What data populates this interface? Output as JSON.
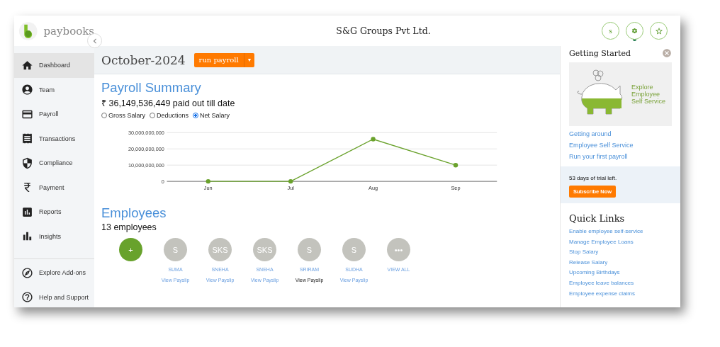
{
  "brand": {
    "name": "paybooks"
  },
  "header": {
    "title": "S&G Groups Pvt Ltd.",
    "icons": [
      {
        "label": "s",
        "selected": false
      },
      {
        "kind": "gear",
        "selected": true
      },
      {
        "kind": "star",
        "selected": false
      }
    ]
  },
  "sidebar": {
    "items": [
      {
        "label": "Dashboard",
        "selected": true
      },
      {
        "label": "Team",
        "selected": false
      },
      {
        "label": "Payroll",
        "selected": false
      },
      {
        "label": "Transactions",
        "selected": false
      },
      {
        "label": "Compliance",
        "selected": false
      },
      {
        "label": "Payment",
        "selected": false
      },
      {
        "label": "Reports",
        "selected": false
      },
      {
        "label": "Insights",
        "selected": false
      }
    ],
    "footer_items": [
      {
        "label": "Explore Add-ons"
      },
      {
        "label": "Help and Support"
      }
    ]
  },
  "period": {
    "title": "October-2024",
    "button": "run payroll",
    "menu_icon": "▾"
  },
  "payroll_summary": {
    "title": "Payroll Summary",
    "total": "₹ 36,149,536,449 paid out till date",
    "options": [
      {
        "label": "Gross Salary",
        "selected": false
      },
      {
        "label": "Deductions",
        "selected": false
      },
      {
        "label": "Net Salary",
        "selected": true
      }
    ],
    "chart_data": {
      "type": "line",
      "categories": [
        "Jun",
        "Jul",
        "Aug",
        "Sep"
      ],
      "series": [
        {
          "color": "#6aa22c",
          "marker": "circle",
          "values": [
            0,
            0,
            26000000000,
            10000000000
          ]
        }
      ],
      "ylim": [
        0,
        30000000000
      ],
      "yticks": [
        {
          "value": 0,
          "label": "0"
        },
        {
          "value": 10000000000,
          "label": "10,000,000,000"
        },
        {
          "value": 20000000000,
          "label": "20,000,000,000"
        },
        {
          "value": 30000000000,
          "label": "30,000,000,000"
        }
      ]
    }
  },
  "employees": {
    "title": "Employees",
    "count": "13 employees",
    "add_label": "+",
    "people": [
      {
        "initials": "S",
        "name": "SUMA",
        "link": "View Payslip",
        "highlighted": false
      },
      {
        "initials": "SKS",
        "name": "SNEHA",
        "link": "View Payslip",
        "highlighted": false
      },
      {
        "initials": "SKS",
        "name": "SNEHA",
        "link": "View Payslip",
        "highlighted": false
      },
      {
        "initials": "S",
        "name": "SRIRAM",
        "link": "View Payslip",
        "highlighted": true
      },
      {
        "initials": "S",
        "name": "SUDHA",
        "link": "View Payslip",
        "highlighted": false
      }
    ],
    "view_all": {
      "icon": "•••",
      "label": "VIEW ALL"
    }
  },
  "getting_started": {
    "title": "Getting Started",
    "banner": "Explore Employee Self Service",
    "links": [
      "Getting around",
      "Employee Self Service",
      "Run your first payroll"
    ]
  },
  "trial": {
    "text": "53 days of trial left.",
    "button": "Subscribe Now"
  },
  "quick_links": {
    "title": "Quick Links",
    "links": [
      "Enable employee self-service",
      "Manage Employee Loans",
      "Stop Salary",
      "Release Salary",
      "Upcoming Birthdays",
      "Employee leave balances",
      "Employee expense claims"
    ]
  }
}
